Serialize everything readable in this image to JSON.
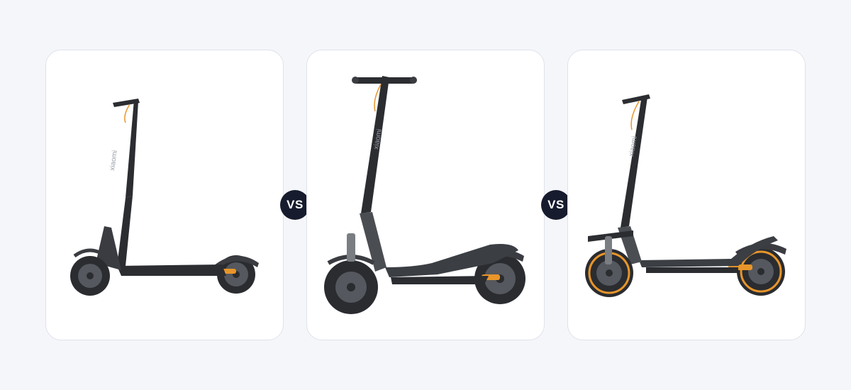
{
  "comparison": {
    "vs_label": "VS",
    "products": [
      {
        "brand_mark": "xiaomi",
        "image": "scooter-standard-icon"
      },
      {
        "brand_mark": "xiaomi",
        "image": "scooter-seat-deck-icon"
      },
      {
        "brand_mark": "xiaomi",
        "image": "scooter-offroad-icon"
      }
    ]
  },
  "colors": {
    "page_background": "#f5f6fa",
    "card_background": "#ffffff",
    "card_border": "#dfe2ea",
    "vs_badge": "#161b2e",
    "accent_orange": "#e8952a",
    "frame_dark": "#2b2d31"
  }
}
